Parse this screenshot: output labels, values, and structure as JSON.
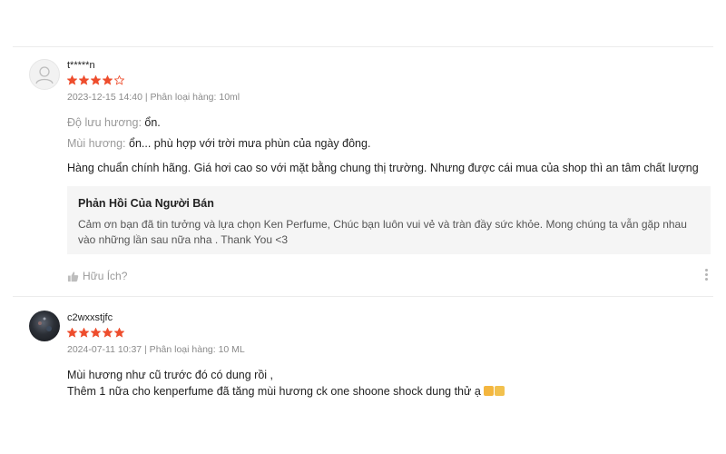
{
  "reviews": [
    {
      "username": "t*****n",
      "rating": 4,
      "max_rating": 5,
      "meta": "2023-12-15 14:40 | Phân loại hàng: 10ml",
      "attributes": [
        {
          "label": "Độ lưu hương:",
          "value": " ổn."
        },
        {
          "label": "Mùi hương:",
          "value": " ổn... phù hợp với trời mưa phùn của ngày đông."
        }
      ],
      "comment": "Hàng chuẩn chính hãng. Giá hơi cao so với mặt bằng chung thị trường. Nhưng được cái mua của shop thì an tâm chất lượng",
      "seller_reply": {
        "title": "Phản Hồi Của Người Bán",
        "line1": "Cảm ơn bạn đã tin tưởng và lựa chọn  Ken Perfume, Chúc bạn luôn vui vẻ và tràn đầy sức khỏe. Mong chúng ta vẫn gặp nhau",
        "line2": "vào những lần sau nữa nha . Thank You <3"
      },
      "helpful_label": "Hữu Ích?"
    },
    {
      "username": "c2wxxstjfc",
      "rating": 5,
      "max_rating": 5,
      "meta": "2024-07-11 10:37 | Phân loại hàng: 10 ML",
      "comment_line1": "Mùi hương như cũ trước đó có dung rồi ,",
      "comment_line2": "Thêm 1 nữa cho kenperfume đã tăng mùi hương ck one shoone shock dung thử ạ"
    }
  ],
  "colors": {
    "star": "#ee4d2d",
    "meta": "#8a8a8a",
    "reply_bg": "#f5f5f5"
  },
  "icons": [
    "user-placeholder-icon",
    "star-icon",
    "thumbs-up-icon",
    "more-options-icon",
    "emoji-icon"
  ]
}
